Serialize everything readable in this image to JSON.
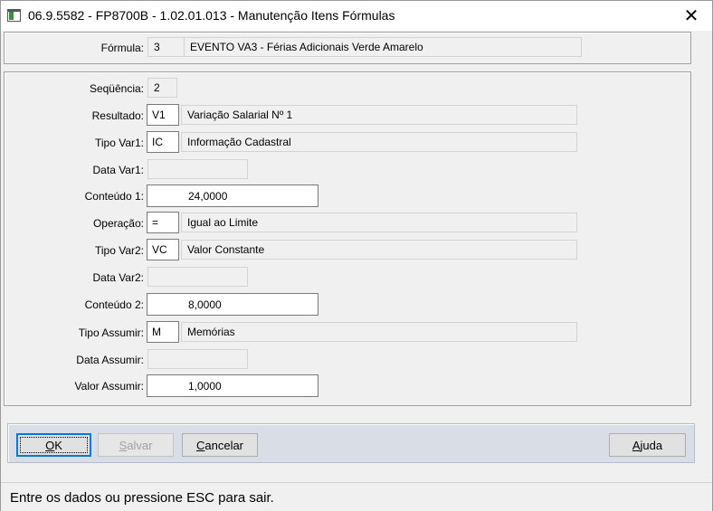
{
  "window": {
    "title": "06.9.5582 - FP8700B - 1.02.01.013 - Manutenção Itens Fórmulas",
    "close": "✕"
  },
  "formula": {
    "label": "Fórmula:",
    "code": "3",
    "description": "EVENTO VA3 - Férias Adicionais Verde Amarelo"
  },
  "fields": {
    "sequencia": {
      "label": "Seqüência:",
      "value": "2"
    },
    "resultado": {
      "label": "Resultado:",
      "code": "V1",
      "description": "Variação Salarial Nº 1"
    },
    "tipo_var1": {
      "label": "Tipo Var1:",
      "code": "IC",
      "description": "Informação Cadastral"
    },
    "data_var1": {
      "label": "Data Var1:",
      "value": ""
    },
    "conteudo1": {
      "label": "Conteúdo 1:",
      "value": "24,0000"
    },
    "operacao": {
      "label": "Operação:",
      "code": "=",
      "description": "Igual ao Limite"
    },
    "tipo_var2": {
      "label": "Tipo Var2:",
      "code": "VC",
      "description": "Valor Constante"
    },
    "data_var2": {
      "label": "Data Var2:",
      "value": ""
    },
    "conteudo2": {
      "label": "Conteúdo 2:",
      "value": "8,0000"
    },
    "tipo_assumir": {
      "label": "Tipo Assumir:",
      "code": "M",
      "description": "Memórias"
    },
    "data_assumir": {
      "label": "Data Assumir:",
      "value": ""
    },
    "valor_assumir": {
      "label": "Valor Assumir:",
      "value": "1,0000"
    }
  },
  "buttons": {
    "ok": {
      "mnemonic": "O",
      "rest": "K"
    },
    "salvar": {
      "mnemonic": "S",
      "rest": "alvar"
    },
    "cancelar": {
      "mnemonic": "C",
      "rest": "ancelar"
    },
    "ajuda": {
      "mnemonic": "A",
      "rest": "juda"
    }
  },
  "status": {
    "text": "Entre os dados ou pressione ESC para sair."
  }
}
